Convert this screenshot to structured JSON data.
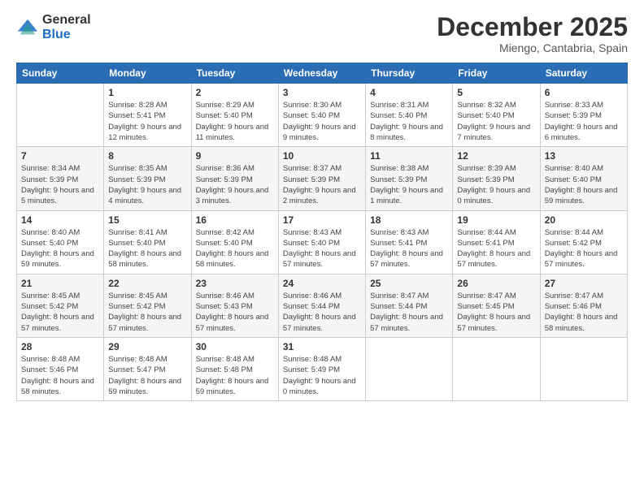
{
  "logo": {
    "general": "General",
    "blue": "Blue"
  },
  "header": {
    "month": "December 2025",
    "location": "Miengo, Cantabria, Spain"
  },
  "weekdays": [
    "Sunday",
    "Monday",
    "Tuesday",
    "Wednesday",
    "Thursday",
    "Friday",
    "Saturday"
  ],
  "weeks": [
    [
      {
        "day": "",
        "sunrise": "",
        "sunset": "",
        "daylight": ""
      },
      {
        "day": "1",
        "sunrise": "Sunrise: 8:28 AM",
        "sunset": "Sunset: 5:41 PM",
        "daylight": "Daylight: 9 hours and 12 minutes."
      },
      {
        "day": "2",
        "sunrise": "Sunrise: 8:29 AM",
        "sunset": "Sunset: 5:40 PM",
        "daylight": "Daylight: 9 hours and 11 minutes."
      },
      {
        "day": "3",
        "sunrise": "Sunrise: 8:30 AM",
        "sunset": "Sunset: 5:40 PM",
        "daylight": "Daylight: 9 hours and 9 minutes."
      },
      {
        "day": "4",
        "sunrise": "Sunrise: 8:31 AM",
        "sunset": "Sunset: 5:40 PM",
        "daylight": "Daylight: 9 hours and 8 minutes."
      },
      {
        "day": "5",
        "sunrise": "Sunrise: 8:32 AM",
        "sunset": "Sunset: 5:40 PM",
        "daylight": "Daylight: 9 hours and 7 minutes."
      },
      {
        "day": "6",
        "sunrise": "Sunrise: 8:33 AM",
        "sunset": "Sunset: 5:39 PM",
        "daylight": "Daylight: 9 hours and 6 minutes."
      }
    ],
    [
      {
        "day": "7",
        "sunrise": "Sunrise: 8:34 AM",
        "sunset": "Sunset: 5:39 PM",
        "daylight": "Daylight: 9 hours and 5 minutes."
      },
      {
        "day": "8",
        "sunrise": "Sunrise: 8:35 AM",
        "sunset": "Sunset: 5:39 PM",
        "daylight": "Daylight: 9 hours and 4 minutes."
      },
      {
        "day": "9",
        "sunrise": "Sunrise: 8:36 AM",
        "sunset": "Sunset: 5:39 PM",
        "daylight": "Daylight: 9 hours and 3 minutes."
      },
      {
        "day": "10",
        "sunrise": "Sunrise: 8:37 AM",
        "sunset": "Sunset: 5:39 PM",
        "daylight": "Daylight: 9 hours and 2 minutes."
      },
      {
        "day": "11",
        "sunrise": "Sunrise: 8:38 AM",
        "sunset": "Sunset: 5:39 PM",
        "daylight": "Daylight: 9 hours and 1 minute."
      },
      {
        "day": "12",
        "sunrise": "Sunrise: 8:39 AM",
        "sunset": "Sunset: 5:39 PM",
        "daylight": "Daylight: 9 hours and 0 minutes."
      },
      {
        "day": "13",
        "sunrise": "Sunrise: 8:40 AM",
        "sunset": "Sunset: 5:40 PM",
        "daylight": "Daylight: 8 hours and 59 minutes."
      }
    ],
    [
      {
        "day": "14",
        "sunrise": "Sunrise: 8:40 AM",
        "sunset": "Sunset: 5:40 PM",
        "daylight": "Daylight: 8 hours and 59 minutes."
      },
      {
        "day": "15",
        "sunrise": "Sunrise: 8:41 AM",
        "sunset": "Sunset: 5:40 PM",
        "daylight": "Daylight: 8 hours and 58 minutes."
      },
      {
        "day": "16",
        "sunrise": "Sunrise: 8:42 AM",
        "sunset": "Sunset: 5:40 PM",
        "daylight": "Daylight: 8 hours and 58 minutes."
      },
      {
        "day": "17",
        "sunrise": "Sunrise: 8:43 AM",
        "sunset": "Sunset: 5:40 PM",
        "daylight": "Daylight: 8 hours and 57 minutes."
      },
      {
        "day": "18",
        "sunrise": "Sunrise: 8:43 AM",
        "sunset": "Sunset: 5:41 PM",
        "daylight": "Daylight: 8 hours and 57 minutes."
      },
      {
        "day": "19",
        "sunrise": "Sunrise: 8:44 AM",
        "sunset": "Sunset: 5:41 PM",
        "daylight": "Daylight: 8 hours and 57 minutes."
      },
      {
        "day": "20",
        "sunrise": "Sunrise: 8:44 AM",
        "sunset": "Sunset: 5:42 PM",
        "daylight": "Daylight: 8 hours and 57 minutes."
      }
    ],
    [
      {
        "day": "21",
        "sunrise": "Sunrise: 8:45 AM",
        "sunset": "Sunset: 5:42 PM",
        "daylight": "Daylight: 8 hours and 57 minutes."
      },
      {
        "day": "22",
        "sunrise": "Sunrise: 8:45 AM",
        "sunset": "Sunset: 5:42 PM",
        "daylight": "Daylight: 8 hours and 57 minutes."
      },
      {
        "day": "23",
        "sunrise": "Sunrise: 8:46 AM",
        "sunset": "Sunset: 5:43 PM",
        "daylight": "Daylight: 8 hours and 57 minutes."
      },
      {
        "day": "24",
        "sunrise": "Sunrise: 8:46 AM",
        "sunset": "Sunset: 5:44 PM",
        "daylight": "Daylight: 8 hours and 57 minutes."
      },
      {
        "day": "25",
        "sunrise": "Sunrise: 8:47 AM",
        "sunset": "Sunset: 5:44 PM",
        "daylight": "Daylight: 8 hours and 57 minutes."
      },
      {
        "day": "26",
        "sunrise": "Sunrise: 8:47 AM",
        "sunset": "Sunset: 5:45 PM",
        "daylight": "Daylight: 8 hours and 57 minutes."
      },
      {
        "day": "27",
        "sunrise": "Sunrise: 8:47 AM",
        "sunset": "Sunset: 5:46 PM",
        "daylight": "Daylight: 8 hours and 58 minutes."
      }
    ],
    [
      {
        "day": "28",
        "sunrise": "Sunrise: 8:48 AM",
        "sunset": "Sunset: 5:46 PM",
        "daylight": "Daylight: 8 hours and 58 minutes."
      },
      {
        "day": "29",
        "sunrise": "Sunrise: 8:48 AM",
        "sunset": "Sunset: 5:47 PM",
        "daylight": "Daylight: 8 hours and 59 minutes."
      },
      {
        "day": "30",
        "sunrise": "Sunrise: 8:48 AM",
        "sunset": "Sunset: 5:48 PM",
        "daylight": "Daylight: 8 hours and 59 minutes."
      },
      {
        "day": "31",
        "sunrise": "Sunrise: 8:48 AM",
        "sunset": "Sunset: 5:49 PM",
        "daylight": "Daylight: 9 hours and 0 minutes."
      },
      {
        "day": "",
        "sunrise": "",
        "sunset": "",
        "daylight": ""
      },
      {
        "day": "",
        "sunrise": "",
        "sunset": "",
        "daylight": ""
      },
      {
        "day": "",
        "sunrise": "",
        "sunset": "",
        "daylight": ""
      }
    ]
  ]
}
